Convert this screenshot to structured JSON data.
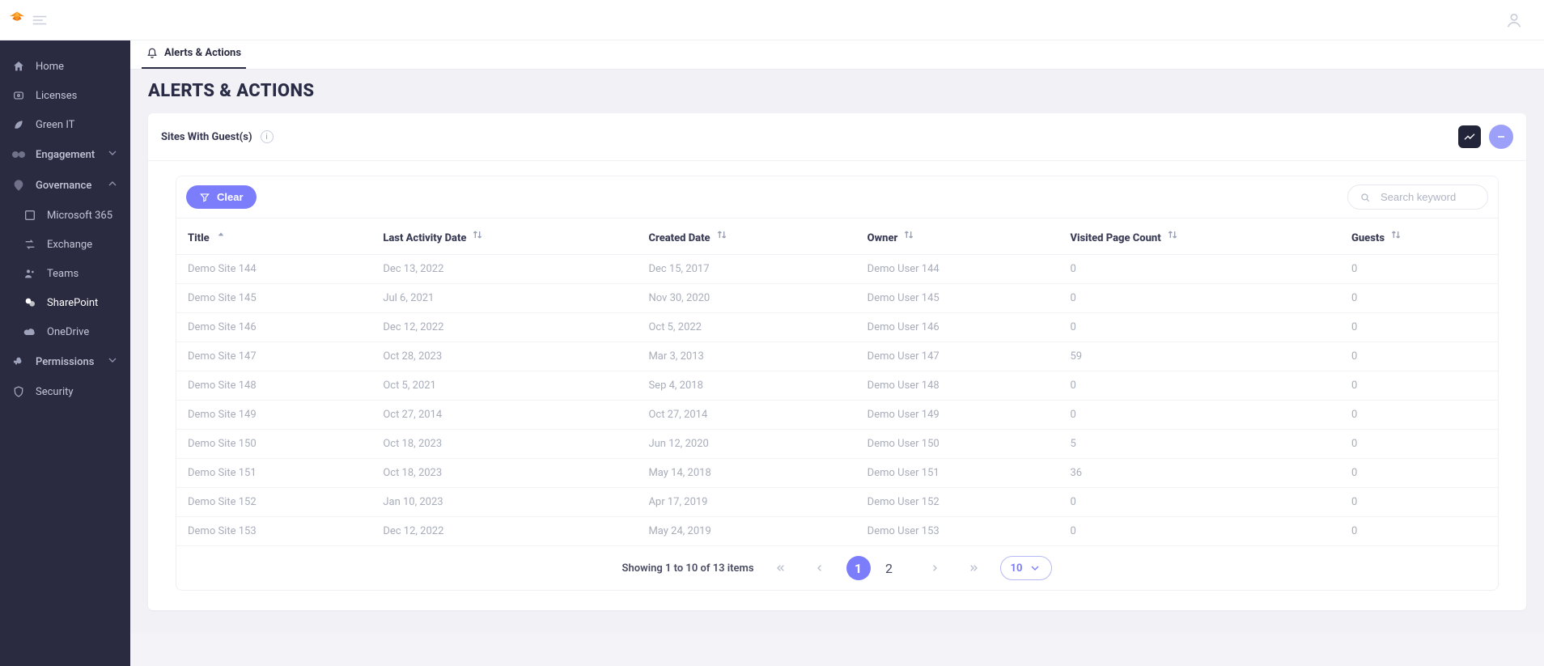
{
  "topbar": {
    "avatar_label": "Profile"
  },
  "sidebar": {
    "items": [
      {
        "label": "Home"
      },
      {
        "label": "Licenses"
      },
      {
        "label": "Green IT"
      },
      {
        "label": "Engagement"
      },
      {
        "label": "Governance"
      },
      {
        "label": "Microsoft 365"
      },
      {
        "label": "Exchange"
      },
      {
        "label": "Teams"
      },
      {
        "label": "SharePoint"
      },
      {
        "label": "OneDrive"
      },
      {
        "label": "Permissions"
      },
      {
        "label": "Security"
      }
    ]
  },
  "tabs": {
    "alerts_actions": "Alerts & Actions"
  },
  "page": {
    "title": "ALERTS & ACTIONS"
  },
  "card": {
    "title": "Sites With Guest(s)"
  },
  "toolbar": {
    "clear_label": "Clear",
    "search_placeholder": "Search keyword"
  },
  "columns": {
    "title": "Title",
    "last_activity": "Last Activity Date",
    "created_date": "Created Date",
    "owner": "Owner",
    "visited_page_count": "Visited Page Count",
    "guests": "Guests"
  },
  "rows": [
    {
      "title": "Demo Site 144",
      "last": "Dec 13, 2022",
      "created": "Dec 15, 2017",
      "owner": "Demo User 144",
      "visited": "0",
      "guests": "0"
    },
    {
      "title": "Demo Site 145",
      "last": "Jul 6, 2021",
      "created": "Nov 30, 2020",
      "owner": "Demo User 145",
      "visited": "0",
      "guests": "0"
    },
    {
      "title": "Demo Site 146",
      "last": "Dec 12, 2022",
      "created": "Oct 5, 2022",
      "owner": "Demo User 146",
      "visited": "0",
      "guests": "0"
    },
    {
      "title": "Demo Site 147",
      "last": "Oct 28, 2023",
      "created": "Mar 3, 2013",
      "owner": "Demo User 147",
      "visited": "59",
      "guests": "0"
    },
    {
      "title": "Demo Site 148",
      "last": "Oct 5, 2021",
      "created": "Sep 4, 2018",
      "owner": "Demo User 148",
      "visited": "0",
      "guests": "0"
    },
    {
      "title": "Demo Site 149",
      "last": "Oct 27, 2014",
      "created": "Oct 27, 2014",
      "owner": "Demo User 149",
      "visited": "0",
      "guests": "0"
    },
    {
      "title": "Demo Site 150",
      "last": "Oct 18, 2023",
      "created": "Jun 12, 2020",
      "owner": "Demo User 150",
      "visited": "5",
      "guests": "0"
    },
    {
      "title": "Demo Site 151",
      "last": "Oct 18, 2023",
      "created": "May 14, 2018",
      "owner": "Demo User 151",
      "visited": "36",
      "guests": "0"
    },
    {
      "title": "Demo Site 152",
      "last": "Jan 10, 2023",
      "created": "Apr 17, 2019",
      "owner": "Demo User 152",
      "visited": "0",
      "guests": "0"
    },
    {
      "title": "Demo Site 153",
      "last": "Dec 12, 2022",
      "created": "May 24, 2019",
      "owner": "Demo User 153",
      "visited": "0",
      "guests": "0"
    }
  ],
  "pagination": {
    "info": "Showing 1 to 10 of 13 items",
    "pages": [
      "1",
      "2"
    ],
    "active_page": "1",
    "page_size": "10"
  }
}
